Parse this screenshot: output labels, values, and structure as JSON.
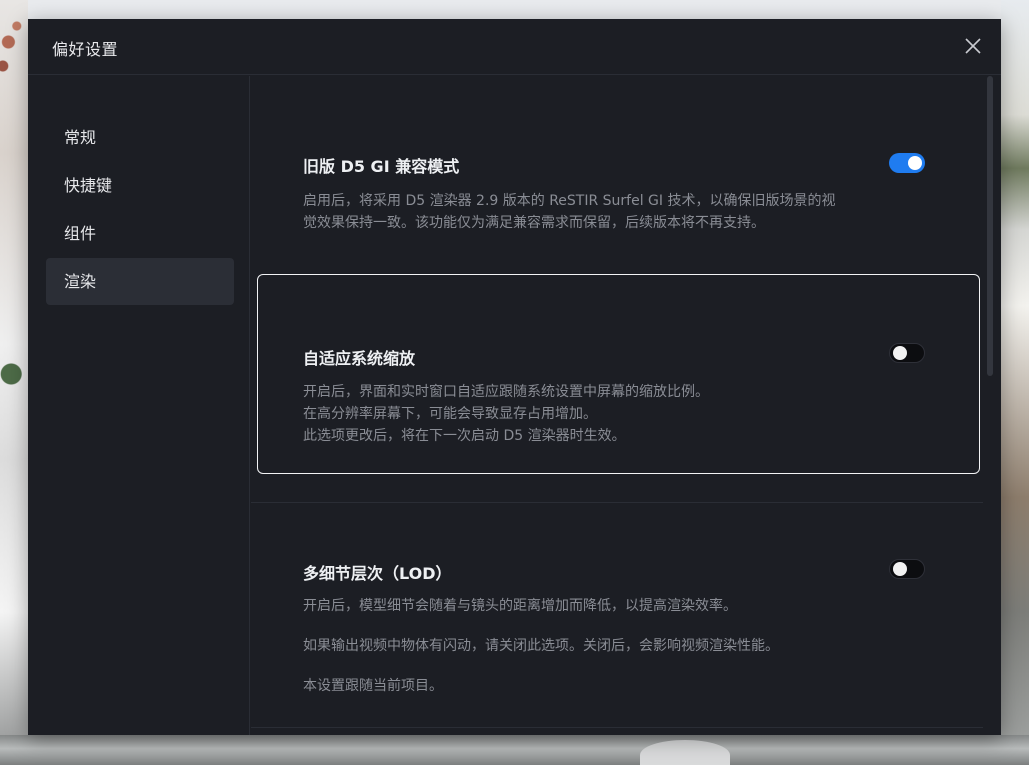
{
  "dialog": {
    "title": "偏好设置",
    "close_icon": "close-icon"
  },
  "sidebar": {
    "items": [
      {
        "label": "常规",
        "active": false
      },
      {
        "label": "快捷键",
        "active": false
      },
      {
        "label": "组件",
        "active": false
      },
      {
        "label": "渲染",
        "active": true
      }
    ]
  },
  "settings": [
    {
      "title": "旧版 D5 GI 兼容模式",
      "enabled": true,
      "description": [
        "启用后，将采用 D5 渲染器 2.9 版本的 ReSTIR Surfel GI 技术，以确保旧版场景的视",
        "觉效果保持一致。该功能仅为满足兼容需求而保留，后续版本将不再支持。"
      ]
    },
    {
      "title": "自适应系统缩放",
      "enabled": false,
      "description": [
        "开启后，界面和实时窗口自适应跟随系统设置中屏幕的缩放比例。",
        "在高分辨率屏幕下，可能会导致显存占用增加。",
        "此选项更改后，将在下一次启动 D5 渲染器时生效。"
      ]
    },
    {
      "title": "多细节层次（LOD）",
      "enabled": false,
      "description": [
        "开启后，模型细节会随着与镜头的距离增加而降低，以提高渲染效率。",
        "如果输出视频中物体有闪动，请关闭此选项。关闭后，会影响视频渲染性能。",
        "本设置跟随当前项目。"
      ]
    }
  ],
  "colors": {
    "accent": "#1f7cf0",
    "panel": "#1c1e24",
    "active_nav": "#2b2e36"
  }
}
